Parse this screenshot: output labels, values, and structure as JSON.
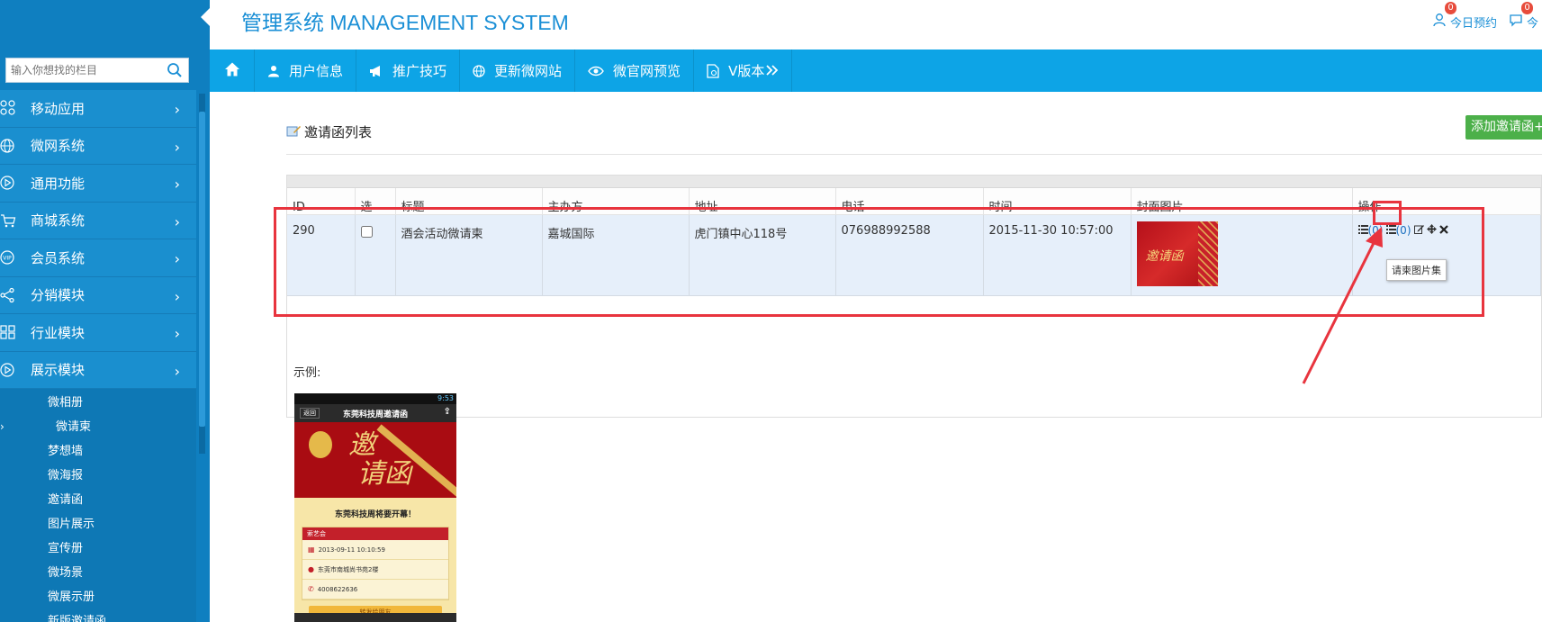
{
  "app": {
    "title": "管理系统 MANAGEMENT SYSTEM",
    "top_right": [
      {
        "label": "今日预约",
        "badge": "0",
        "icon": "user-icon"
      },
      {
        "label": "今",
        "badge": "0",
        "icon": "comment-icon"
      }
    ]
  },
  "sidebar": {
    "search_placeholder": "输入你想找的栏目",
    "menu": [
      {
        "label": "移动应用",
        "icon": "apps-icon"
      },
      {
        "label": "微网系统",
        "icon": "globe-icon"
      },
      {
        "label": "通用功能",
        "icon": "play-circle-icon"
      },
      {
        "label": "商城系统",
        "icon": "cart-icon"
      },
      {
        "label": "会员系统",
        "icon": "vip-icon"
      },
      {
        "label": "分销模块",
        "icon": "share-icon"
      },
      {
        "label": "行业模块",
        "icon": "grid-icon"
      },
      {
        "label": "展示模块",
        "icon": "play-circle-icon"
      }
    ],
    "submenu": [
      {
        "label": "微相册",
        "active": false
      },
      {
        "label": "微请柬",
        "active": true
      },
      {
        "label": "梦想墙",
        "active": false
      },
      {
        "label": "微海报",
        "active": false
      },
      {
        "label": "邀请函",
        "active": false
      },
      {
        "label": "图片展示",
        "active": false
      },
      {
        "label": "宣传册",
        "active": false
      },
      {
        "label": "微场景",
        "active": false
      },
      {
        "label": "微展示册",
        "active": false
      },
      {
        "label": "新版邀请函",
        "active": false
      }
    ],
    "chevron": "›"
  },
  "navbar": {
    "items": [
      {
        "label": "用户信息",
        "icon": "user-icon"
      },
      {
        "label": "推广技巧",
        "icon": "bullhorn-icon"
      },
      {
        "label": "更新微网站",
        "icon": "globe-icon"
      },
      {
        "label": "微官网预览",
        "icon": "eye-icon"
      },
      {
        "label": "V版本",
        "icon": "file-icon"
      }
    ]
  },
  "main": {
    "list_title": "邀请函列表",
    "add_button": "添加邀请函+",
    "example_label": "示例:",
    "tooltip": "请柬图片集"
  },
  "table": {
    "headers": [
      "ID",
      "选",
      "标题",
      "主办方",
      "地址",
      "电话",
      "时间",
      "封面图片",
      "操作"
    ],
    "rows": [
      {
        "id": "290",
        "title": "酒会活动微请柬",
        "host": "嘉城国际",
        "address": "虎门镇中心118号",
        "phone": "076988992588",
        "time": "2015-11-30 10:57:00",
        "cover_text": "邀请函",
        "ops": {
          "photos_count": "(0)",
          "list_count": "(0)"
        }
      }
    ]
  },
  "phone_preview": {
    "status_time": "9:53",
    "back": "返回",
    "header": "东莞科技周邀请函",
    "banner_line1": "邀",
    "banner_line2": "请函",
    "tagline": "东莞科技周将要开幕！",
    "card_title": "萦艺会",
    "date": "2013-09-11 10:10:59",
    "address": "东莞市南城尚书苑2楼",
    "phone": "4008622636",
    "button": "转发给朋友"
  },
  "colors": {
    "sidebar": "#0f7fc0",
    "navbar": "#0da4e6",
    "accent": "#1a8fd6",
    "add_button": "#4cb04a",
    "highlight": "#e8343e"
  }
}
